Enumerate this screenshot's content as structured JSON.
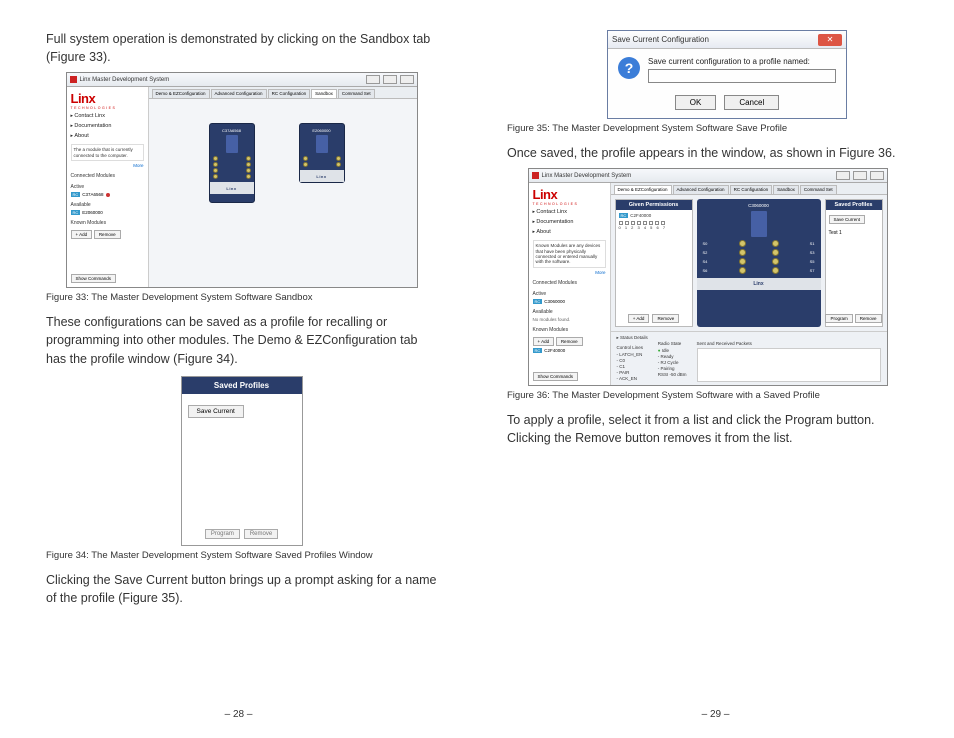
{
  "left": {
    "p1": "Full system operation is demonstrated by clicking on the Sandbox tab (Figure 33).",
    "cap33": "Figure 33: The Master Development System Software Sandbox",
    "p2": "These configurations can be saved as a profile for recalling or programming into other modules. The Demo & EZConfiguration tab has the profile window (Figure 34).",
    "cap34": "Figure 34: The Master Development System Software Saved Profiles Window",
    "p3": "Clicking the Save Current button brings up a prompt asking for a name of the profile (Figure 35).",
    "page": "28"
  },
  "right": {
    "cap35": "Figure 35: The Master Development System Software Save Profile",
    "p1": "Once saved, the profile appears in the window, as shown in Figure 36.",
    "cap36": "Figure 36: The Master Development System Software with a Saved Profile",
    "p2": "To apply a profile, select it from a list and click the Program button. Clicking the Remove button removes it from the list.",
    "page": "29"
  },
  "app": {
    "title": "Linx Master Development System",
    "logo": "Linx",
    "logosub": "TECHNOLOGIES",
    "nav": {
      "a": "Contact Linx",
      "b": "Documentation",
      "c": "About"
    },
    "info33": "The a module that is currently connected to the computer.",
    "more": "More",
    "connected": "Connected Modules",
    "active": "Active",
    "available": "Available",
    "known": "Known Modules",
    "mod1": "C37A6568",
    "mod2": "E2060000",
    "rc": "RC",
    "addbtn": "+ Add",
    "removebtn": "Remove",
    "showcmd": "Show Commands",
    "tabs": {
      "t1": "Demo & EZConfiguration",
      "t2": "Advanced Configuration",
      "t3": "RC Configuration",
      "t4": "Sandbox",
      "t5": "Command Set"
    }
  },
  "fig34": {
    "head": "Saved Profiles",
    "save": "Save Current",
    "program": "Program",
    "remove": "Remove"
  },
  "fig35": {
    "title": "Save Current Configuration",
    "msg": "Save current configuration to a profile named:",
    "ok": "OK",
    "cancel": "Cancel"
  },
  "fig36": {
    "info": "Known Modules are any devices that have been physically connected or entered manually with the software.",
    "nomod": "No modules found.",
    "gp": "Given Permissions",
    "gpmod": "C2F40000",
    "gpnums": "0   1   2   3   4   5   6   7",
    "sp": "Saved Profiles",
    "save": "Save Current",
    "test1": "Test 1",
    "program": "Program",
    "remove": "Remove",
    "mod": "C3060000",
    "s0": "S0",
    "s1": "S1",
    "s2": "S2",
    "s3": "S3",
    "s4": "S4",
    "s5": "S5",
    "s6": "S6",
    "s7": "S7",
    "statushdr": "▸ Status Details",
    "clhdr": "Control Lines",
    "cl1": "LATCH_EN",
    "cl2": "C0",
    "cl3": "C1",
    "cl4": "PAIR",
    "cl5": "ACK_EN",
    "rshdr": "Radio State",
    "rs1": "Idle",
    "rs2": "Ready",
    "rs3": "RJ Cycle",
    "rs4": "Pairing",
    "rssi": "RSSI   -50    dBm",
    "srhdr": "Sent and Received Packets"
  }
}
